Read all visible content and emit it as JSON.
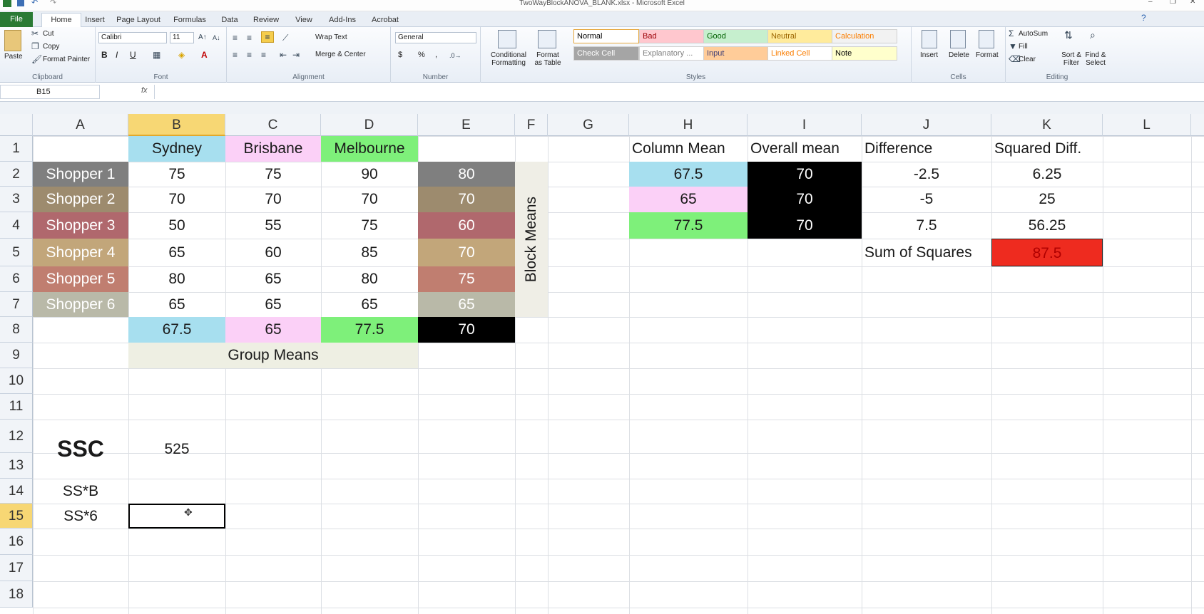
{
  "window": {
    "title": "TwoWayBlockANOVA_BLANK.xlsx - Microsoft Excel"
  },
  "tabs": [
    "File",
    "Home",
    "Insert",
    "Page Layout",
    "Formulas",
    "Data",
    "Review",
    "View",
    "Add-Ins",
    "Acrobat"
  ],
  "ribbon": {
    "clipboard": {
      "paste": "Paste",
      "cut": "Cut",
      "copy": "Copy",
      "format_painter": "Format Painter",
      "label": "Clipboard"
    },
    "font": {
      "name": "Calibri",
      "size": "11",
      "label": "Font",
      "bold": "B",
      "italic": "I",
      "underline": "U"
    },
    "alignment": {
      "wrap": "Wrap Text",
      "merge": "Merge & Center",
      "label": "Alignment"
    },
    "number": {
      "format": "General",
      "currency": "$",
      "percent": "%",
      "comma": ",",
      "label": "Number"
    },
    "styles": {
      "conditional": "Conditional Formatting",
      "format_table": "Format as Table",
      "label": "Styles",
      "boxes": [
        {
          "name": "Normal",
          "bg": "#ffffff",
          "fg": "#000000"
        },
        {
          "name": "Bad",
          "bg": "#ffc7ce",
          "fg": "#9c0006"
        },
        {
          "name": "Good",
          "bg": "#c6efce",
          "fg": "#006100"
        },
        {
          "name": "Neutral",
          "bg": "#ffeb9c",
          "fg": "#9c6500"
        },
        {
          "name": "Calculation",
          "bg": "#f2f2f2",
          "fg": "#fa7d00"
        },
        {
          "name": "Check Cell",
          "bg": "#a5a5a5",
          "fg": "#ffffff"
        },
        {
          "name": "Explanatory ...",
          "bg": "#ffffff",
          "fg": "#7f7f7f"
        },
        {
          "name": "Input",
          "bg": "#ffcc99",
          "fg": "#3f3f76"
        },
        {
          "name": "Linked Cell",
          "bg": "#ffffff",
          "fg": "#fa7d00"
        },
        {
          "name": "Note",
          "bg": "#ffffcc",
          "fg": "#000000"
        }
      ]
    },
    "cells": {
      "insert": "Insert",
      "delete": "Delete",
      "format": "Format",
      "label": "Cells"
    },
    "editing": {
      "autosum": "AutoSum",
      "fill": "Fill",
      "clear": "Clear",
      "sort": "Sort & Filter",
      "find": "Find & Select",
      "label": "Editing"
    }
  },
  "formula_bar": {
    "name_box": "B15",
    "fx": "fx",
    "value": ""
  },
  "columns": [
    "A",
    "B",
    "C",
    "D",
    "E",
    "F",
    "G",
    "H",
    "I",
    "J",
    "K",
    "L"
  ],
  "selected_col": "B",
  "rows": [
    "1",
    "2",
    "3",
    "4",
    "5",
    "6",
    "7",
    "8",
    "9",
    "10",
    "11",
    "12",
    "13",
    "14",
    "15",
    "16",
    "17",
    "18"
  ],
  "selected_row": "15",
  "table": {
    "headers": [
      {
        "text": "Sydney",
        "bg": "#a7dfef"
      },
      {
        "text": "Brisbane",
        "bg": "#fbd0f7"
      },
      {
        "text": "Melbourne",
        "bg": "#7ef07a"
      }
    ],
    "shoppers": [
      {
        "label": "Shopper 1",
        "bg": "#7f7f7f",
        "vals": [
          "75",
          "75",
          "90"
        ],
        "mean": "80"
      },
      {
        "label": "Shopper 2",
        "bg": "#9d8b6e",
        "vals": [
          "70",
          "70",
          "70"
        ],
        "mean": "70"
      },
      {
        "label": "Shopper 3",
        "bg": "#b0686d",
        "vals": [
          "50",
          "55",
          "75"
        ],
        "mean": "60"
      },
      {
        "label": "Shopper 4",
        "bg": "#c2a67a",
        "vals": [
          "65",
          "60",
          "85"
        ],
        "mean": "70"
      },
      {
        "label": "Shopper 5",
        "bg": "#c07e70",
        "vals": [
          "80",
          "65",
          "80"
        ],
        "mean": "75"
      },
      {
        "label": "Shopper 6",
        "bg": "#b9b9a8",
        "vals": [
          "65",
          "65",
          "65"
        ],
        "mean": "65"
      }
    ],
    "group_means": [
      "67.5",
      "65",
      "77.5"
    ],
    "overall": "70",
    "group_means_label": "Group Means",
    "block_means_label": "Block Means"
  },
  "right": {
    "headers": [
      "Column Mean",
      "Overall mean",
      "Difference",
      "Squared Diff."
    ],
    "rows": [
      {
        "mean": "67.5",
        "overall": "70",
        "diff": "-2.5",
        "sq": "6.25",
        "bg": "#a7dfef"
      },
      {
        "mean": "65",
        "overall": "70",
        "diff": "-5",
        "sq": "25",
        "bg": "#fbd0f7"
      },
      {
        "mean": "77.5",
        "overall": "70",
        "diff": "7.5",
        "sq": "56.25",
        "bg": "#7ef07a"
      }
    ],
    "sum_label": "Sum of Squares",
    "sum_value": "87.5",
    "sum_bg": "#ee2b1f"
  },
  "lower": {
    "ssc_label": "SSC",
    "ssc_value": "525",
    "ssb_label": "SS*B",
    "ss6_label": "SS*6"
  }
}
